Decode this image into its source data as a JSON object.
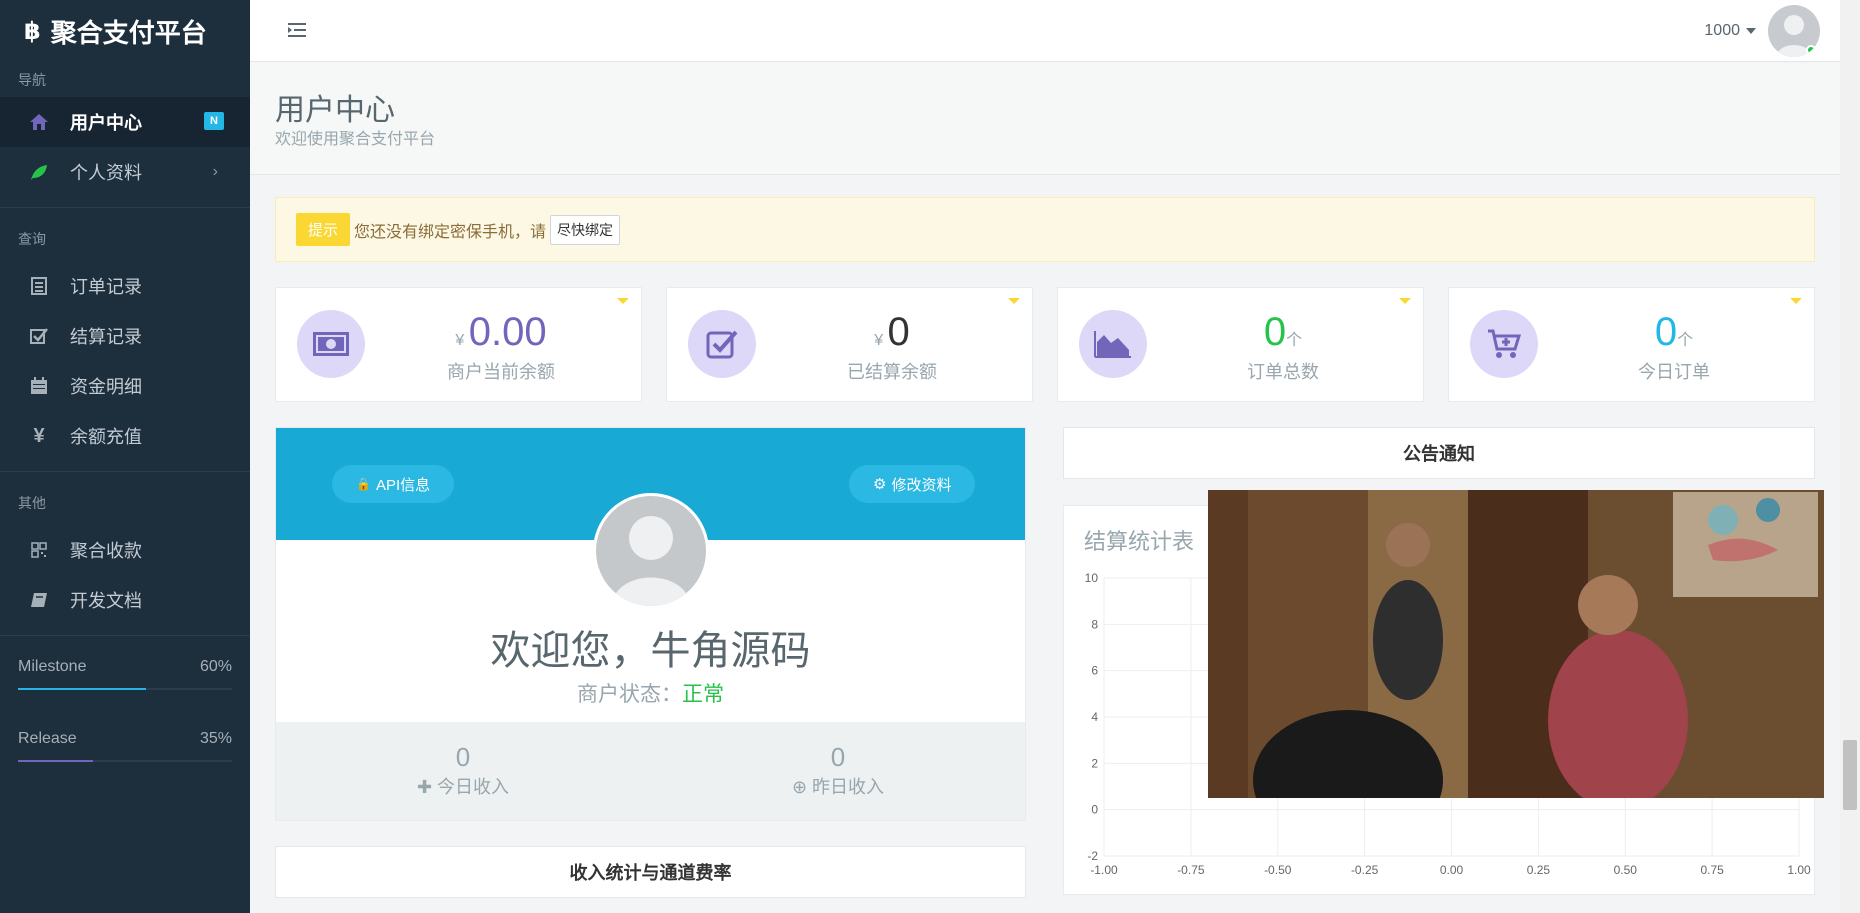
{
  "sidebar": {
    "brand": "聚合支付平台",
    "sections": [
      "导航",
      "查询",
      "其他"
    ],
    "nav": [
      {
        "label": "用户中心",
        "badge": "N",
        "icon": "home-icon"
      },
      {
        "label": "个人资料",
        "icon": "leaf-icon"
      }
    ],
    "query": [
      {
        "label": "订单记录",
        "icon": "list-icon"
      },
      {
        "label": "结算记录",
        "icon": "check-square-icon"
      },
      {
        "label": "资金明细",
        "icon": "calendar-icon"
      },
      {
        "label": "余额充值",
        "icon": "yen-icon"
      }
    ],
    "other": [
      {
        "label": "聚合收款",
        "icon": "qrcode-icon"
      },
      {
        "label": "开发文档",
        "icon": "book-icon"
      }
    ],
    "progress": [
      {
        "label": "Milestone",
        "value_text": "60%",
        "value": 60,
        "color": "#23b7e5"
      },
      {
        "label": "Release",
        "value_text": "35%",
        "value": 35,
        "color": "#7266ba"
      }
    ]
  },
  "header": {
    "user": "1000"
  },
  "page": {
    "title": "用户中心",
    "subtitle": "欢迎使用聚合支付平台"
  },
  "notice": {
    "tag": "提示",
    "text": "您还没有绑定密保手机，请",
    "button": "尽快绑定"
  },
  "stats": [
    {
      "prefix": "¥",
      "value": "0.00",
      "suffix": "",
      "label": "商户当前余额",
      "color": "#7266ba"
    },
    {
      "prefix": "¥",
      "value": "0",
      "suffix": "",
      "label": "已结算余额",
      "color": "#333333"
    },
    {
      "prefix": "",
      "value": "0",
      "suffix": "个",
      "label": "订单总数",
      "color": "#27c24c"
    },
    {
      "prefix": "",
      "value": "0",
      "suffix": "个",
      "label": "今日订单",
      "color": "#23b7e5"
    }
  ],
  "profile": {
    "api_button": "API信息",
    "edit_button": "修改资料",
    "welcome": "欢迎您，牛角源码",
    "status_label": "商户状态：",
    "status_value": "正常",
    "today_income_value": "0",
    "today_income_label": "今日收入",
    "yesterday_income_value": "0",
    "yesterday_income_label": "昨日收入"
  },
  "panels": {
    "announcement": "公告通知",
    "income_stats": "收入统计与通道费率"
  },
  "chart_data": {
    "type": "line",
    "title": "结算统计表",
    "x_ticks": [
      "-1.00",
      "-0.75",
      "-0.50",
      "-0.25",
      "0.00",
      "0.25",
      "0.50",
      "0.75",
      "1.00"
    ],
    "y_ticks": [
      "10",
      "8",
      "6",
      "4",
      "2",
      "0",
      "-2"
    ],
    "xlim": [
      -1,
      1
    ],
    "ylim": [
      -2,
      10
    ],
    "series": [],
    "grid": true
  }
}
